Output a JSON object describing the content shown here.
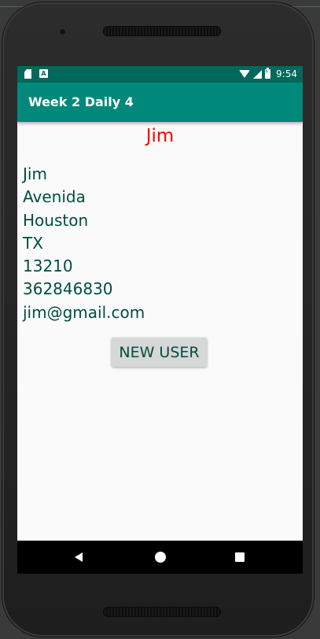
{
  "status_bar": {
    "time": "9:54",
    "a_badge": "A",
    "icons": [
      "sd-card-icon",
      "a-badge-icon",
      "wifi-icon",
      "signal-icon",
      "battery-charging-icon"
    ]
  },
  "app_bar": {
    "title": "Week 2 Daily 4",
    "color": "#00897b"
  },
  "user": {
    "heading": "Jim",
    "heading_color": "#ff0000",
    "name": "Jim",
    "street": "Avenida",
    "city": "Houston",
    "state": "TX",
    "zip": "13210",
    "phone": "362846830",
    "email": "jim@gmail.com"
  },
  "actions": {
    "new_user_label": "NEW USER"
  },
  "nav_bar": {
    "icons": [
      "back-icon",
      "home-icon",
      "recents-icon"
    ]
  }
}
